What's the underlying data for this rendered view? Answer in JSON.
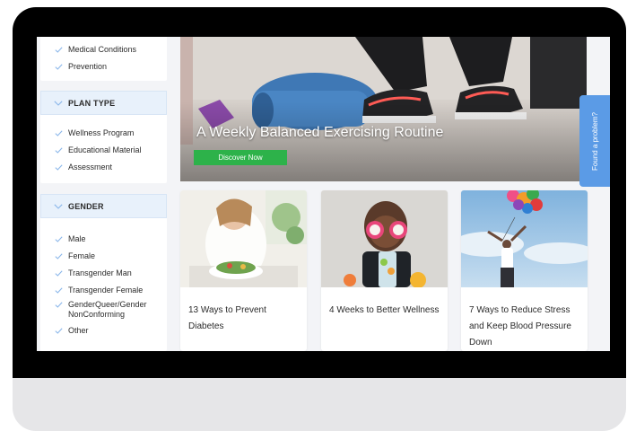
{
  "sidebar": {
    "top_items": [
      "Medical Conditions",
      "Prevention"
    ],
    "groups": [
      {
        "title": "PLAN TYPE",
        "items": [
          "Wellness Program",
          "Educational Material",
          "Assessment"
        ]
      },
      {
        "title": "GENDER",
        "items": [
          "Male",
          "Female",
          "Transgender Man",
          "Transgender Female",
          "GenderQueer/Gender NonConforming",
          "Other"
        ]
      }
    ]
  },
  "hero": {
    "title": "A Weekly Balanced Exercising Routine",
    "button_label": "Discover Now"
  },
  "feedback_tab": {
    "label": "Found a problem?"
  },
  "cards": [
    {
      "title": "13 Ways to Prevent Diabetes"
    },
    {
      "title": "4 Weeks to Better Wellness"
    },
    {
      "title": "7 Ways to Reduce Stress and Keep Blood Pressure Down"
    }
  ],
  "colors": {
    "accent_green": "#2db24a",
    "filter_header_bg": "#e8f1fb",
    "check_blue": "#8bb7ea",
    "feedback_blue": "#5b9be6",
    "device_bezel": "#000000"
  },
  "icons": {
    "checkmark": "check-icon",
    "group_toggle": "chevron-down-icon"
  }
}
